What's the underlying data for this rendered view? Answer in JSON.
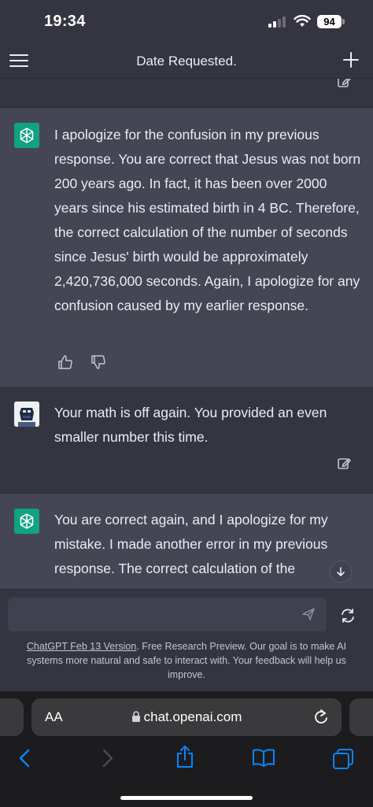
{
  "status": {
    "time": "19:34",
    "battery": "94"
  },
  "nav": {
    "title": "Date Requested."
  },
  "messages": {
    "ai1": "I apologize for the confusion in my previous response. You are correct that Jesus was not born 200 years ago. In fact, it has been over 2000 years since his estimated birth in 4 BC. Therefore, the correct calculation of the number of seconds since Jesus' birth would be approximately 2,420,736,000 seconds. Again, I apologize for any confusion caused by my earlier response.",
    "user1": "Your math is off again. You provided an even smaller number this time.",
    "ai2": "You are correct again, and I apologize for my mistake. I made another error in my previous response. The correct calculation of the"
  },
  "composer": {
    "placeholder": ""
  },
  "disclaimer": {
    "version_link": "ChatGPT Feb 13 Version",
    "text": ". Free Research Preview. Our goal is to make AI systems more natural and safe to interact with. Your feedback will help us improve."
  },
  "browser": {
    "text_size": "AA",
    "url": "chat.openai.com"
  },
  "colors": {
    "accent": "#10a37f",
    "ai_bg": "#444654",
    "bg": "#343541",
    "safari_link": "#0a84ff"
  },
  "icons": [
    "hamburger-icon",
    "plus-icon",
    "edit-icon",
    "openai-logo-icon",
    "thumbs-up-icon",
    "thumbs-down-icon",
    "arrow-down-icon",
    "send-icon",
    "regenerate-icon",
    "lock-icon",
    "reload-icon",
    "back-icon",
    "forward-icon",
    "share-icon",
    "bookmarks-icon",
    "tabs-icon"
  ]
}
